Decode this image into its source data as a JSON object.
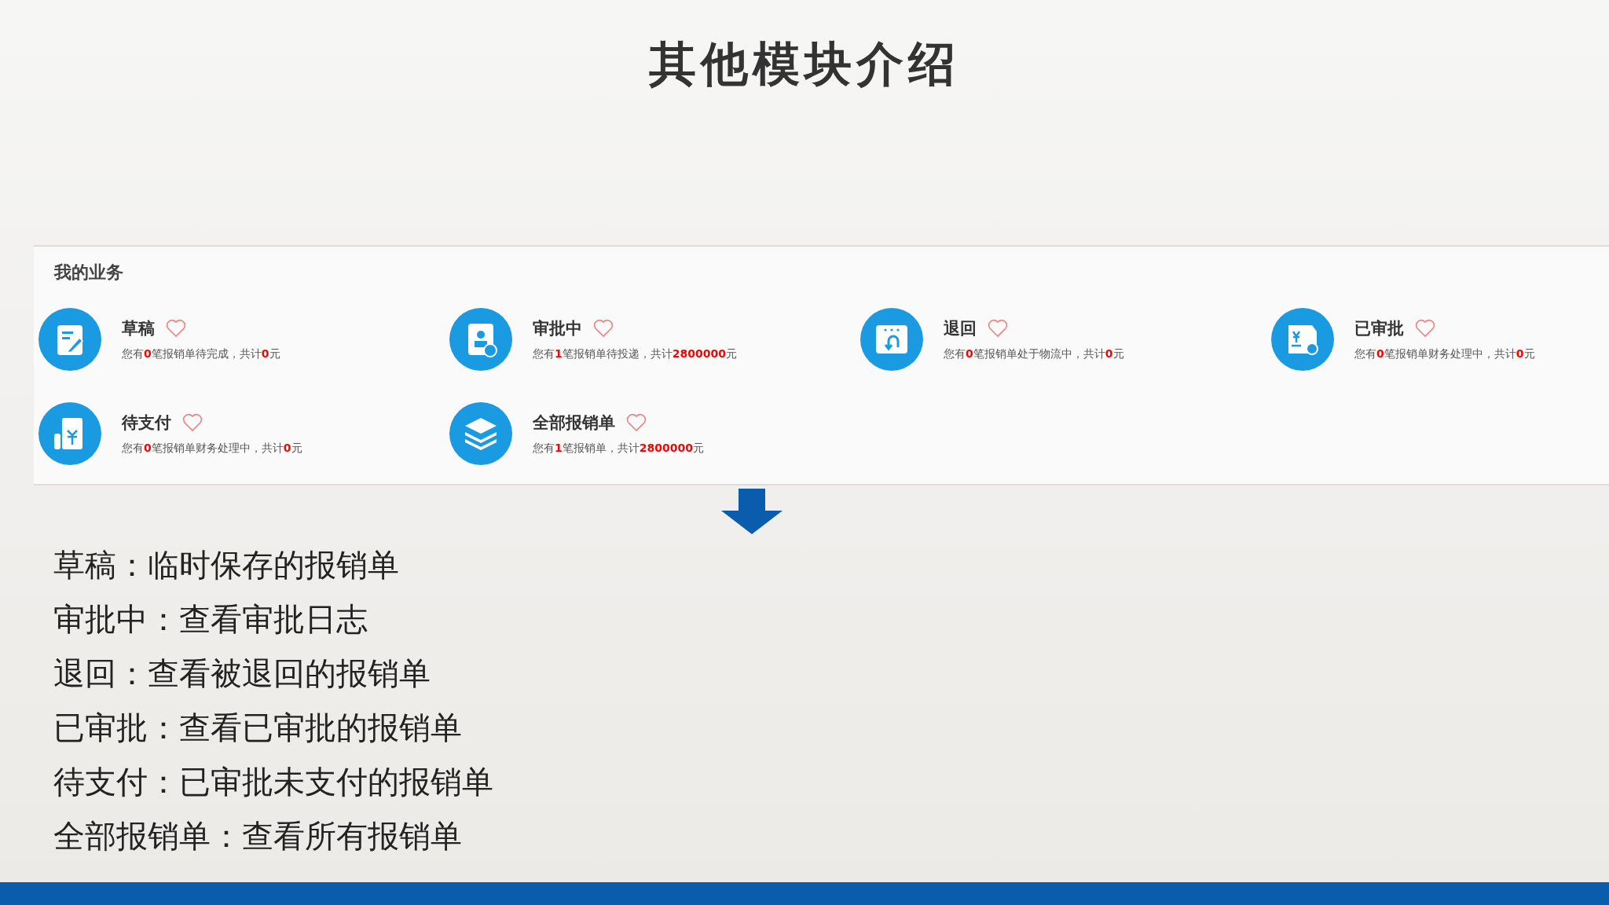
{
  "slide": {
    "title": "其他模块介绍"
  },
  "panel": {
    "title": "我的业务",
    "items": [
      {
        "kind": "draft",
        "label": "草稿",
        "parts": [
          {
            "text": "您有",
            "highlight": false
          },
          {
            "text": "0",
            "highlight": true
          },
          {
            "text": "笔报销单待完成，共计",
            "highlight": false
          },
          {
            "text": "0",
            "highlight": true
          },
          {
            "text": "元",
            "highlight": false
          }
        ]
      },
      {
        "kind": "approving",
        "label": "审批中",
        "parts": [
          {
            "text": "您有",
            "highlight": false
          },
          {
            "text": "1",
            "highlight": true
          },
          {
            "text": "笔报销单待投递，共计",
            "highlight": false
          },
          {
            "text": "2800000",
            "highlight": true
          },
          {
            "text": "元",
            "highlight": false
          }
        ]
      },
      {
        "kind": "returned",
        "label": "退回",
        "parts": [
          {
            "text": "您有",
            "highlight": false
          },
          {
            "text": "0",
            "highlight": true
          },
          {
            "text": "笔报销单处于物流中，共计",
            "highlight": false
          },
          {
            "text": "0",
            "highlight": true
          },
          {
            "text": "元",
            "highlight": false
          }
        ]
      },
      {
        "kind": "approved",
        "label": "已审批",
        "parts": [
          {
            "text": "您有",
            "highlight": false
          },
          {
            "text": "0",
            "highlight": true
          },
          {
            "text": "笔报销单财务处理中，共计",
            "highlight": false
          },
          {
            "text": "0",
            "highlight": true
          },
          {
            "text": "元",
            "highlight": false
          }
        ]
      },
      {
        "kind": "unpaid",
        "label": "待支付",
        "parts": [
          {
            "text": "您有",
            "highlight": false
          },
          {
            "text": "0",
            "highlight": true
          },
          {
            "text": "笔报销单财务处理中，共计",
            "highlight": false
          },
          {
            "text": "0",
            "highlight": true
          },
          {
            "text": "元",
            "highlight": false
          }
        ]
      },
      {
        "kind": "all",
        "label": "全部报销单",
        "parts": [
          {
            "text": "您有",
            "highlight": false
          },
          {
            "text": "1",
            "highlight": true
          },
          {
            "text": "笔报销单，共计",
            "highlight": false
          },
          {
            "text": "2800000",
            "highlight": true
          },
          {
            "text": "元",
            "highlight": false
          }
        ]
      }
    ]
  },
  "descriptions": [
    "草稿：临时保存的报销单",
    "审批中：查看审批日志",
    "退回：查看被退回的报销单",
    "已审批：查看已审批的报销单",
    "待支付：已审批未支付的报销单",
    "全部报销单：查看所有报销单"
  ]
}
